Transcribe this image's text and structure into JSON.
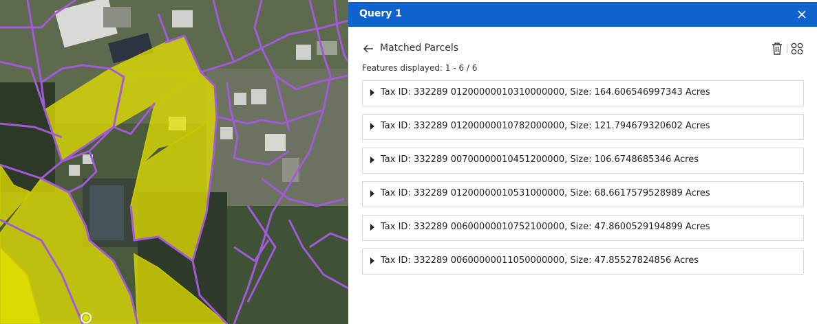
{
  "panel": {
    "title": "Query 1",
    "back_label": "Matched Parcels",
    "features_displayed": "Features displayed: 1 - 6 / 6",
    "results": [
      {
        "label": "Tax ID: 332289 01200000010310000000, Size: 164.606546997343 Acres"
      },
      {
        "label": "Tax ID: 332289 01200000010782000000, Size: 121.794679320602 Acres"
      },
      {
        "label": "Tax ID: 332289 00700000010451200000, Size: 106.6748685346 Acres"
      },
      {
        "label": "Tax ID: 332289 01200000010531000000, Size: 68.6617579528989 Acres"
      },
      {
        "label": "Tax ID: 332289 00600000010752100000, Size: 47.8600529194899 Acres"
      },
      {
        "label": "Tax ID: 332289 00600000011050000000, Size: 47.85527824856 Acres"
      }
    ]
  },
  "icons": {
    "close": "close-icon",
    "back": "arrow-left-icon",
    "delete": "trash-icon",
    "grid": "grid-icon",
    "expand": "caret-right-icon"
  },
  "colors": {
    "header_bg": "#0f63cf",
    "parcel_outline": "#a25bd8",
    "selected_parcel": "#e5e300"
  }
}
